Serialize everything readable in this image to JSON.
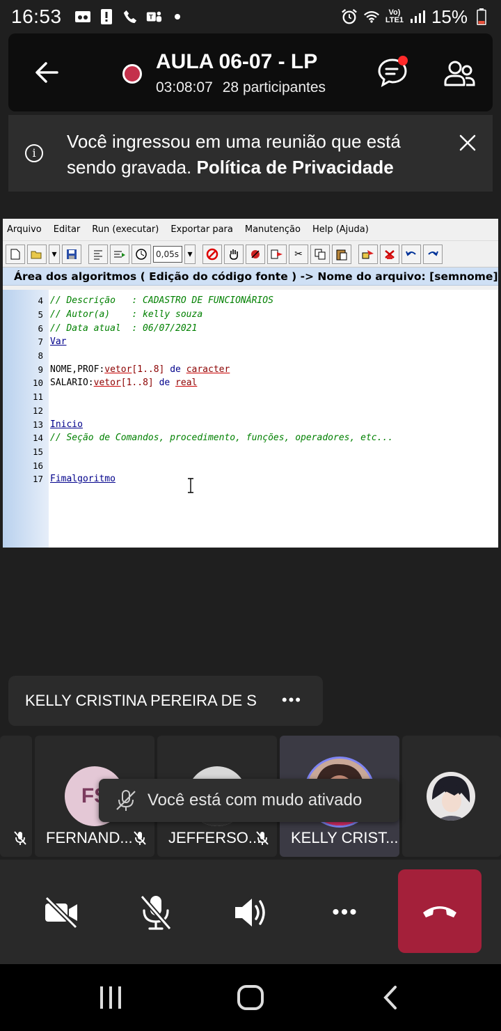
{
  "status_bar": {
    "time": "16:53",
    "battery": "15%",
    "network": "LTE1"
  },
  "meeting": {
    "title": "AULA 06-07 - LP",
    "duration": "03:08:07",
    "participants": "28 participantes"
  },
  "banner": {
    "text": "Você ingressou em uma reunião que está sendo gravada.",
    "link": "Política de Privacidade"
  },
  "app": {
    "menu": [
      "Arquivo",
      "Editar",
      "Run (executar)",
      "Exportar para",
      "Manutenção",
      "Help (Ajuda)"
    ],
    "speed": "0,05s",
    "area_title": "Área dos algoritmos ( Edição do código fonte ) -> Nome do arquivo: [semnome]",
    "code": [
      {
        "n": "4",
        "t": "// Descrição   : CADASTRO DE FUNCIONÁRIOS"
      },
      {
        "n": "5",
        "t": "// Autor(a)    : kelly souza"
      },
      {
        "n": "6",
        "t": "// Data atual  : 06/07/2021"
      },
      {
        "n": "7",
        "t": "Var"
      },
      {
        "n": "8",
        "t": ""
      },
      {
        "n": "9",
        "t": "NOME,PROF:vetor[1..8] de caracter"
      },
      {
        "n": "10",
        "t": "SALARIO:vetor[1..8] de real"
      },
      {
        "n": "11",
        "t": ""
      },
      {
        "n": "12",
        "t": ""
      },
      {
        "n": "13",
        "t": "Inicio"
      },
      {
        "n": "14",
        "t": "// Seção de Comandos, procedimento, funções, operadores, etc..."
      },
      {
        "n": "15",
        "t": ""
      },
      {
        "n": "16",
        "t": ""
      },
      {
        "n": "17",
        "t": "Fimalgoritmo"
      }
    ]
  },
  "speaker": {
    "name": "KELLY CRISTINA PEREIRA DE S",
    "more": "•••"
  },
  "participants": [
    {
      "name": "FERNAND...",
      "initials": "FS"
    },
    {
      "name": "JEFFERSO..."
    },
    {
      "name": "KELLY CRIST..."
    }
  ],
  "toast": {
    "text": "Você está com mudo ativado"
  },
  "controls": {
    "more": "•••"
  },
  "colors": {
    "header_bg": "#0d0d0d",
    "hangup": "#a4203a",
    "recording": "#c4314b",
    "accent": "#ff2a2a"
  }
}
